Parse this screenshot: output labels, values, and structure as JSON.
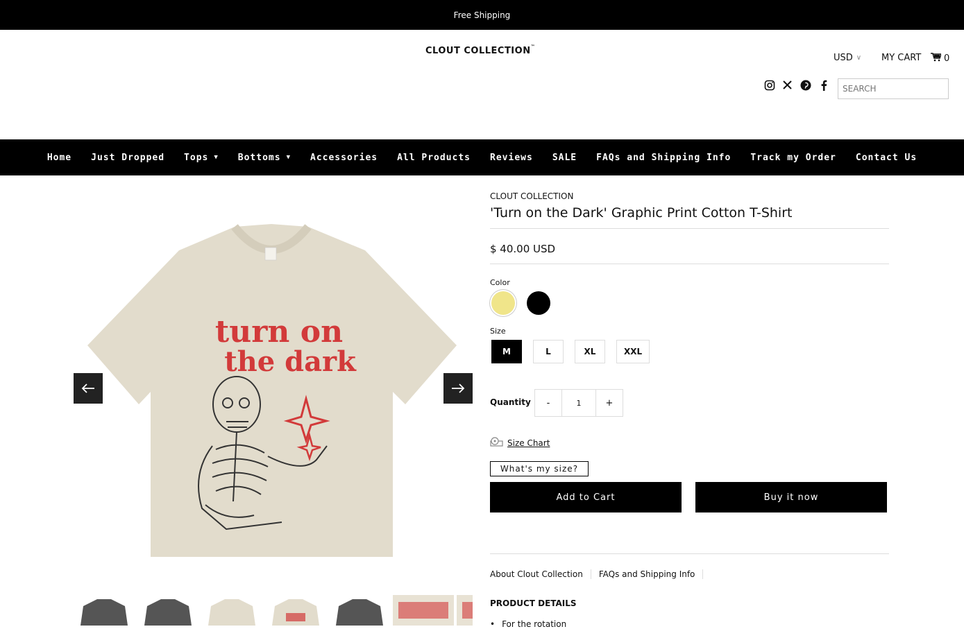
{
  "announcement": "Free Shipping",
  "header": {
    "logo_text": "CLOUT COLLECTION",
    "logo_tm": "™",
    "currency": "USD",
    "cart_label": "MY CART",
    "cart_count": "0",
    "search_placeholder": "SEARCH",
    "social_icons": [
      "instagram-icon",
      "x-icon",
      "pinterest-icon",
      "facebook-icon"
    ]
  },
  "nav": {
    "items": [
      {
        "label": "Home",
        "dropdown": false
      },
      {
        "label": "Just Dropped",
        "dropdown": false
      },
      {
        "label": "Tops",
        "dropdown": true
      },
      {
        "label": "Bottoms",
        "dropdown": true
      },
      {
        "label": "Accessories",
        "dropdown": false
      },
      {
        "label": "All Products",
        "dropdown": false
      },
      {
        "label": "Reviews",
        "dropdown": false
      },
      {
        "label": "SALE",
        "dropdown": false
      },
      {
        "label": "FAQs and Shipping Info",
        "dropdown": false
      },
      {
        "label": "Track my Order",
        "dropdown": false
      },
      {
        "label": "Contact Us",
        "dropdown": false
      }
    ]
  },
  "product": {
    "vendor": "CLOUT COLLECTION",
    "title": "'Turn on the Dark' Graphic Print Cotton T-Shirt",
    "price": "$ 40.00 USD",
    "color_label": "Color",
    "colors": [
      {
        "name": "cream",
        "hex": "#f0e58a",
        "selected": true
      },
      {
        "name": "black",
        "hex": "#000000",
        "selected": false
      }
    ],
    "size_label": "Size",
    "sizes": [
      {
        "label": "M",
        "selected": true
      },
      {
        "label": "L",
        "selected": false
      },
      {
        "label": "XL",
        "selected": false
      },
      {
        "label": "XXL",
        "selected": false
      }
    ],
    "quantity_label": "Quantity",
    "qty_minus": "-",
    "quantity": "1",
    "qty_plus": "+",
    "size_chart_label": "Size Chart",
    "whats_my_size": "What's my size?",
    "add_to_cart": "Add to Cart",
    "buy_now": "Buy it now",
    "print_lines": [
      "turn on",
      "the dark"
    ],
    "shirt_color": "#e2dccc",
    "print_color": "#d23a3a"
  },
  "info_tabs": [
    "About Clout Collection",
    "FAQs and Shipping Info"
  ],
  "details": {
    "heading": "PRODUCT DETAILS",
    "bullets": [
      "For the rotation"
    ]
  },
  "gallery": {
    "prev_icon": "arrow-left-icon",
    "next_icon": "arrow-right-icon",
    "thumbnails": [
      "grey",
      "grey",
      "cream",
      "cream",
      "grey",
      "cream-closeup",
      "cream-closeup"
    ]
  }
}
